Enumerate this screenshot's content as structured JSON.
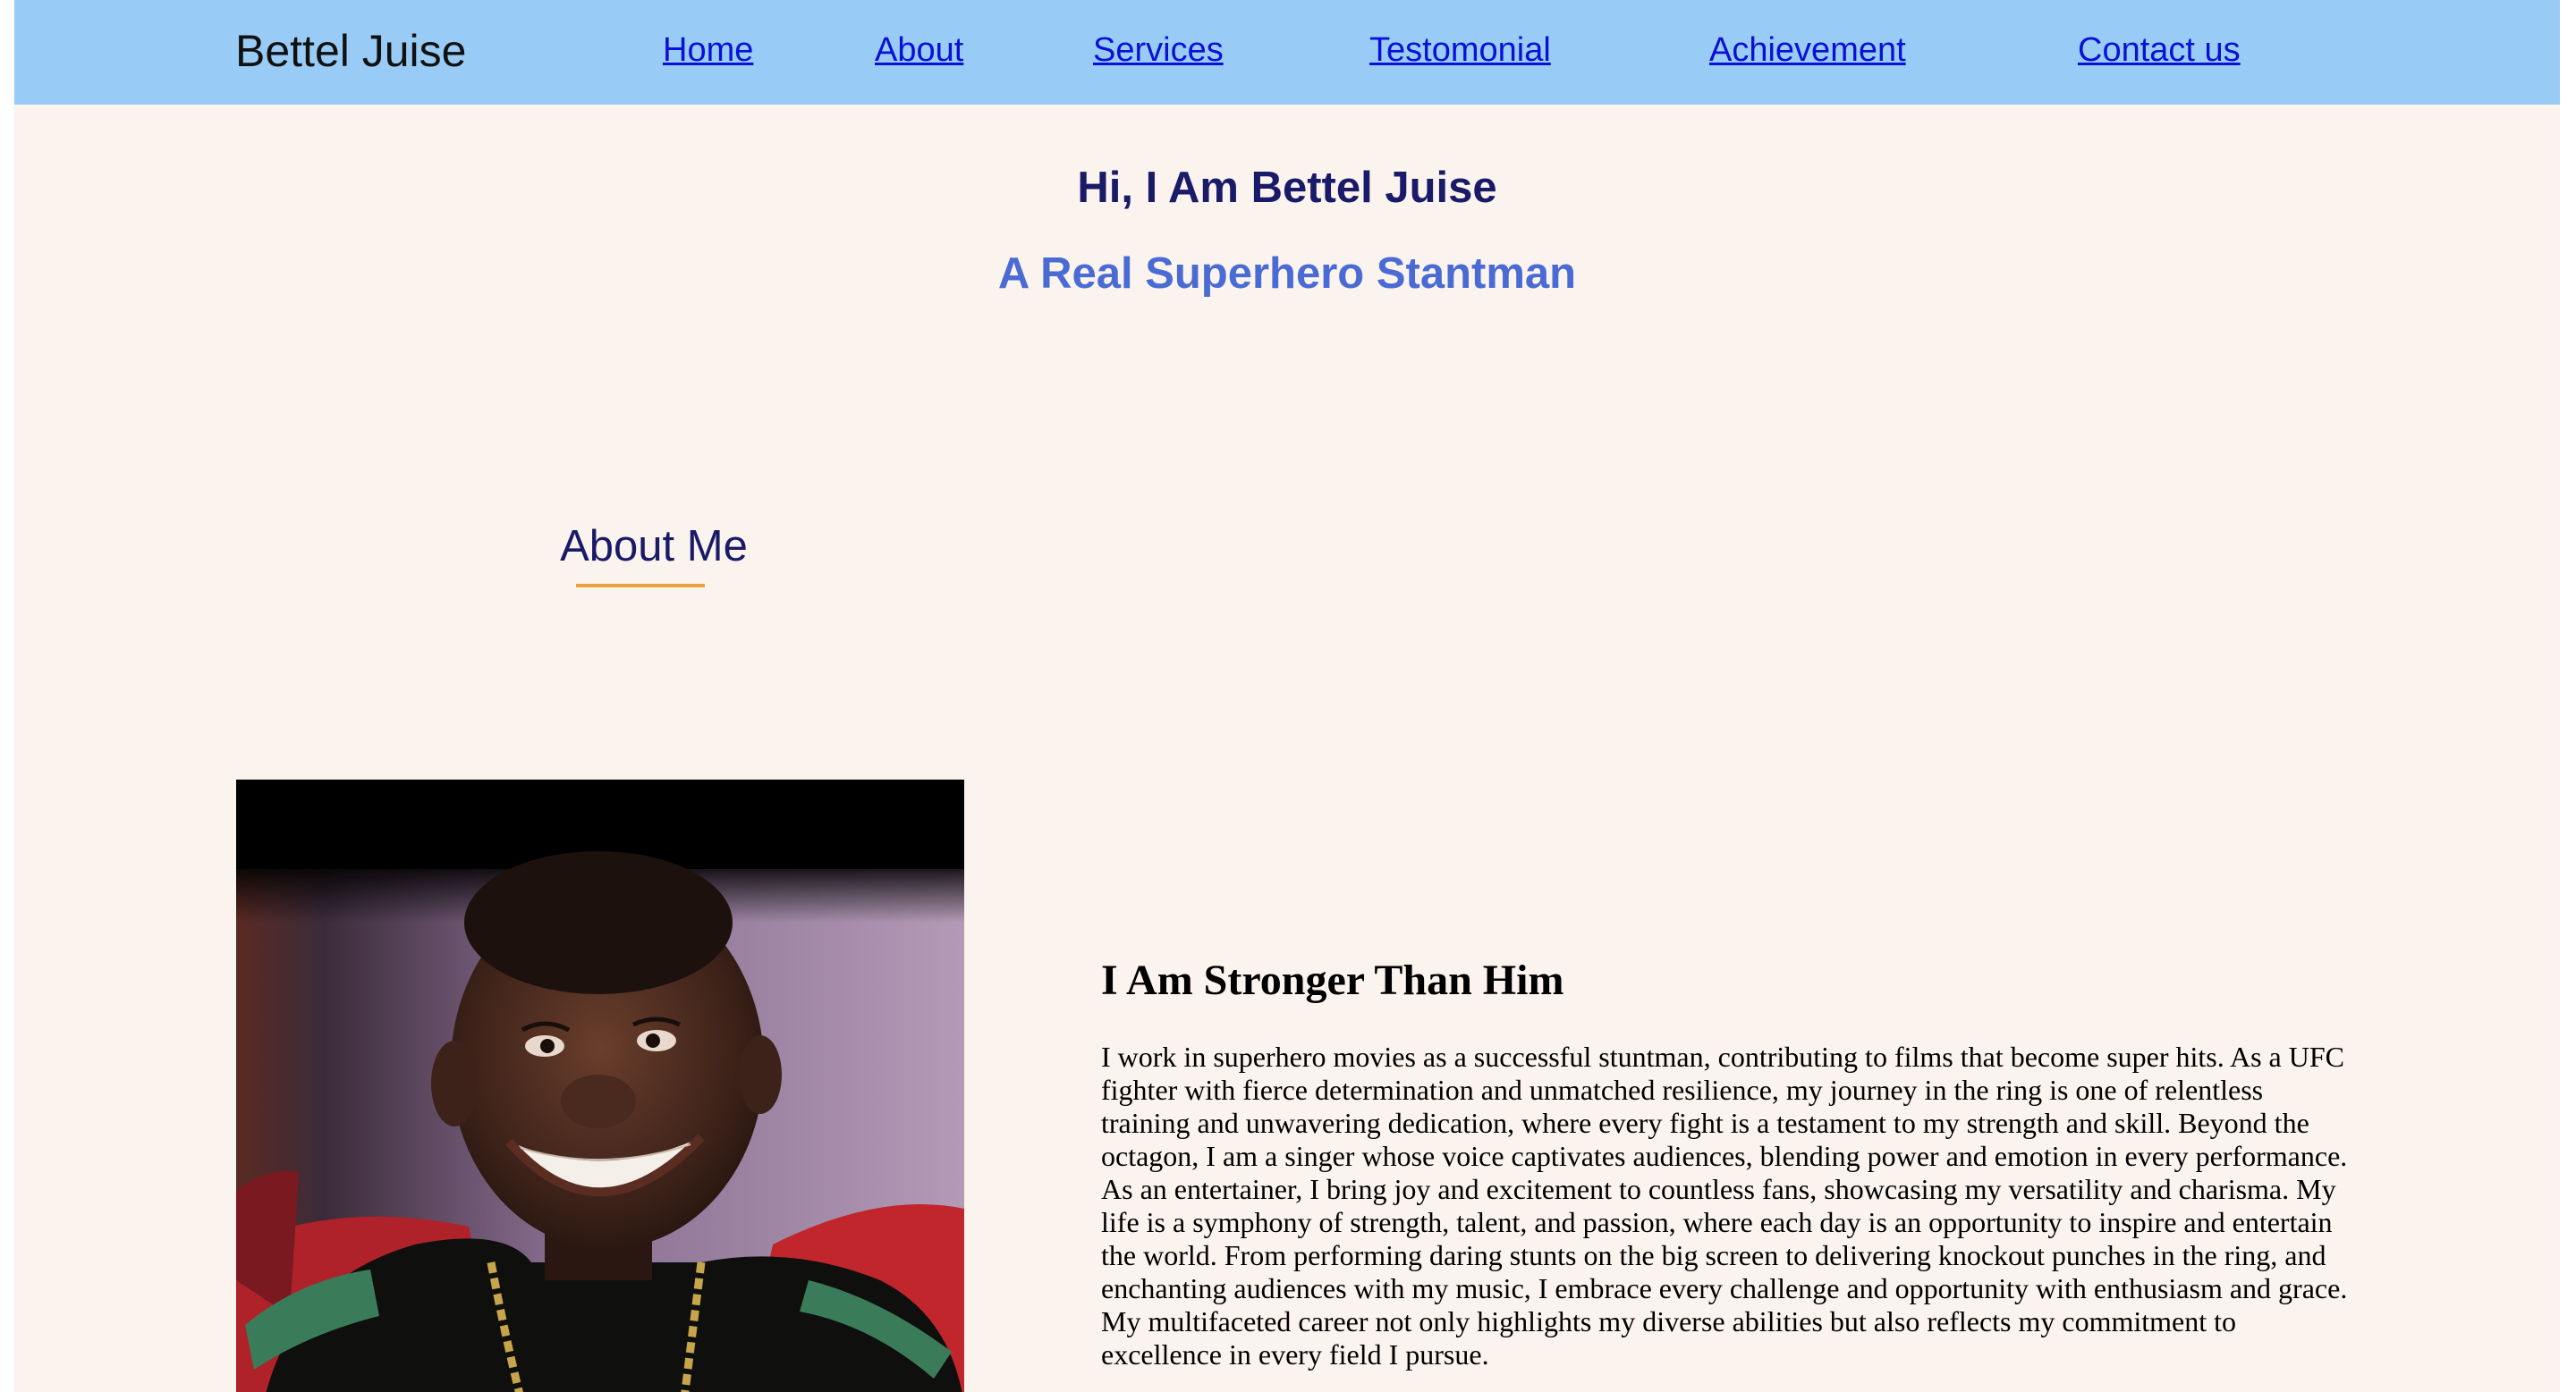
{
  "header": {
    "brand": "Bettel Juise",
    "nav": [
      {
        "label": "Home"
      },
      {
        "label": "About"
      },
      {
        "label": "Services"
      },
      {
        "label": "Testomonial"
      },
      {
        "label": "Achievement"
      },
      {
        "label": "Contact us"
      }
    ]
  },
  "hero": {
    "title": "Hi, I Am Bettel Juise",
    "subtitle": "A Real Superhero Stantman"
  },
  "about": {
    "heading": "About Me",
    "content_title": "I Am Stronger Than Him",
    "content_text": "I work in superhero movies as a successful stuntman, contributing to films that become super hits. As a UFC fighter with fierce determination and unmatched resilience, my journey in the ring is one of relentless training and unwavering dedication, where every fight is a testament to my strength and skill. Beyond the octagon, I am a singer whose voice captivates audiences, blending power and emotion in every performance. As an entertainer, I bring joy and excitement to countless fans, showcasing my versatility and charisma. My life is a symphony of strength, talent, and passion, where each day is an opportunity to inspire and entertain the world. From performing daring stunts on the big screen to delivering knockout punches in the ring, and enchanting audiences with my music, I embrace every challenge and opportunity with enthusiasm and grace. My multifaceted career not only highlights my diverse abilities but also reflects my commitment to excellence in every field I pursue."
  },
  "colors": {
    "nav_background": "#98ccf6",
    "page_background": "#fbf3ee",
    "link": "#0a10d6",
    "heading_dark": "#191a68",
    "heading_accent": "#4a6bd3",
    "underline_accent": "#f0a13a"
  }
}
